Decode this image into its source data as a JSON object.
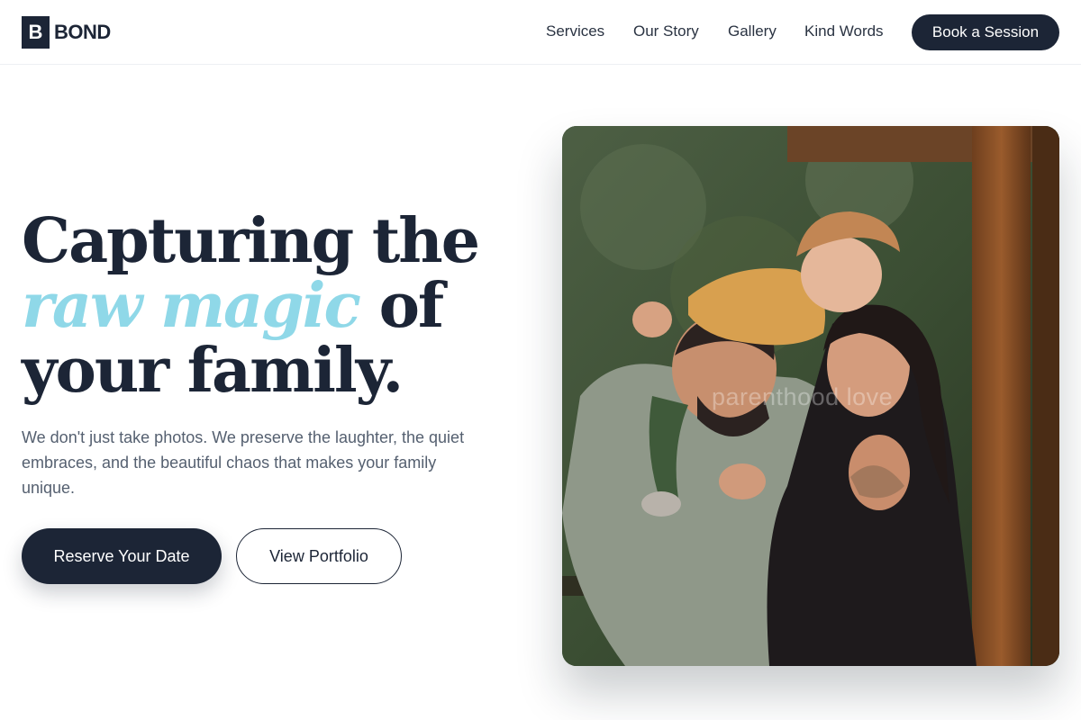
{
  "brand": {
    "mark": "B",
    "name": "BOND"
  },
  "nav": {
    "items": [
      {
        "label": "Services"
      },
      {
        "label": "Our Story"
      },
      {
        "label": "Gallery"
      },
      {
        "label": "Kind Words"
      }
    ],
    "cta_label": "Book a Session"
  },
  "hero": {
    "headline_line1": "Capturing the",
    "headline_accent": "raw magic",
    "headline_line2_rest": " of",
    "headline_line3": "your family.",
    "subtext": "We don't just take photos. We preserve the laughter, the quiet embraces, and the beautiful chaos that makes your family unique.",
    "primary_button": "Reserve Your Date",
    "secondary_button": "View Portfolio"
  },
  "photo": {
    "watermark": "parenthood love"
  },
  "colors": {
    "primary": "#1c2536",
    "accent": "#8fd8e8",
    "body_text": "#556070"
  }
}
